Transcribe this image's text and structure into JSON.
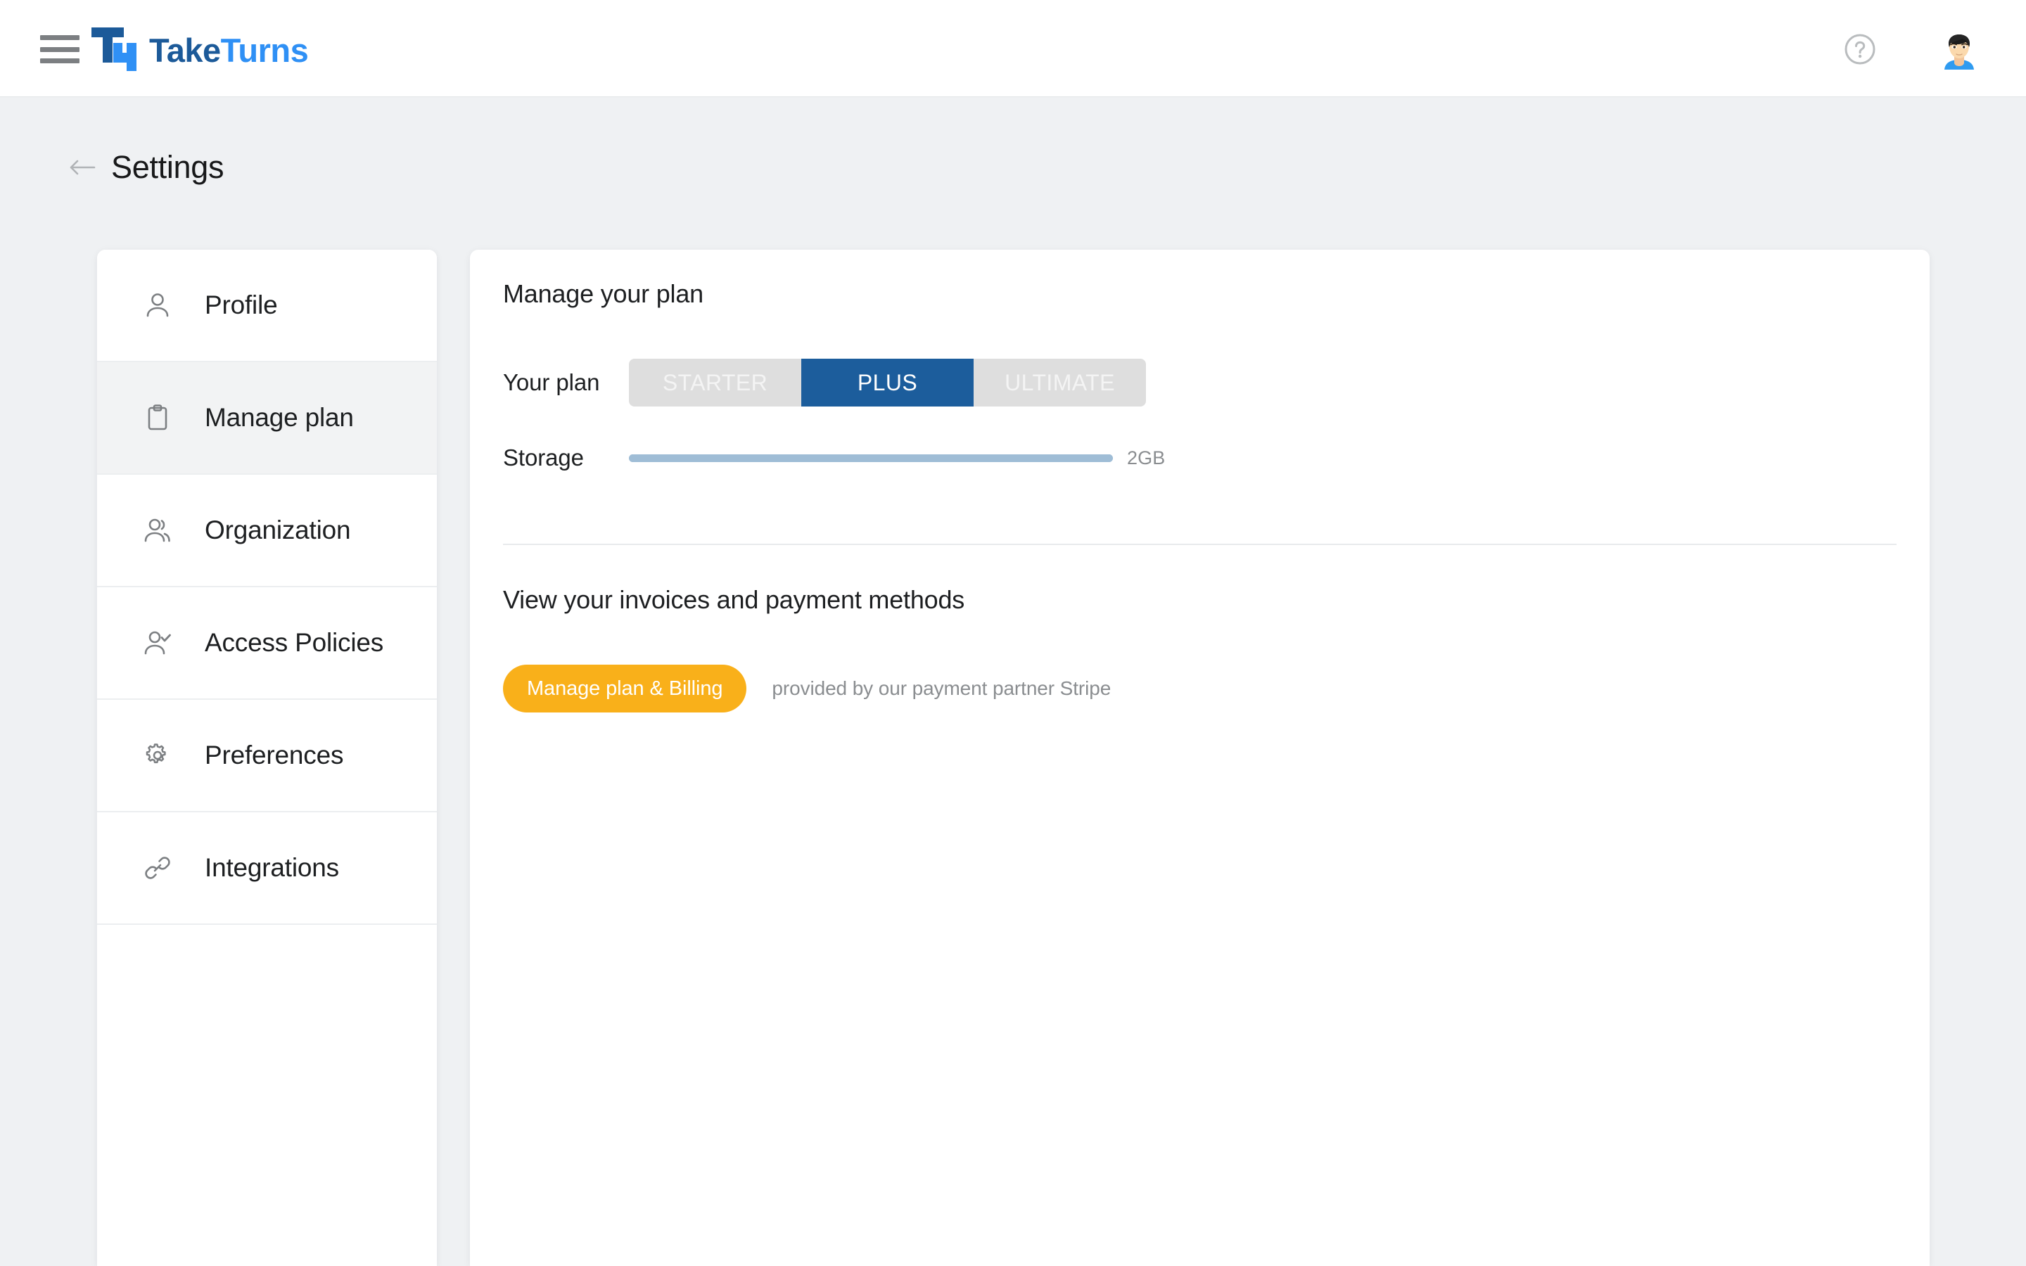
{
  "brand": {
    "name_part1": "Take",
    "name_part2": "Turns",
    "logo_icon": "taketurns-logo-icon",
    "primary_dark": "#1c5a99",
    "primary_light": "#2f90f5"
  },
  "topbar": {
    "menu_icon": "hamburger-menu-icon",
    "help_icon": "help-circle-icon",
    "avatar_alt": "user-avatar"
  },
  "page": {
    "title": "Settings",
    "back_icon": "arrow-left-icon",
    "background": "#eff1f3"
  },
  "sidebar": {
    "items": [
      {
        "label": "Profile",
        "icon": "user-icon",
        "active": false
      },
      {
        "label": "Manage plan",
        "icon": "clipboard-icon",
        "active": true
      },
      {
        "label": "Organization",
        "icon": "users-icon",
        "active": false
      },
      {
        "label": "Access Policies",
        "icon": "user-check-icon",
        "active": false
      },
      {
        "label": "Preferences",
        "icon": "gear-icon",
        "active": false
      },
      {
        "label": "Integrations",
        "icon": "link-icon",
        "active": false
      }
    ]
  },
  "main": {
    "plan_section_title": "Manage your plan",
    "plan_label": "Your plan",
    "plans": [
      {
        "label": "STARTER",
        "selected": false
      },
      {
        "label": "PLUS",
        "selected": true
      },
      {
        "label": "ULTIMATE",
        "selected": false
      }
    ],
    "selected_plan": "PLUS",
    "selected_plan_color": "#1c5d9c",
    "storage_label": "Storage",
    "storage_value": "2GB",
    "storage_percent": 100,
    "storage_bar_color": "#9fbdd6",
    "invoices_section_title": "View your invoices and payment methods",
    "billing_button_label": "Manage plan & Billing",
    "billing_button_color": "#f9b01a",
    "billing_note": "provided by our payment partner Stripe"
  }
}
